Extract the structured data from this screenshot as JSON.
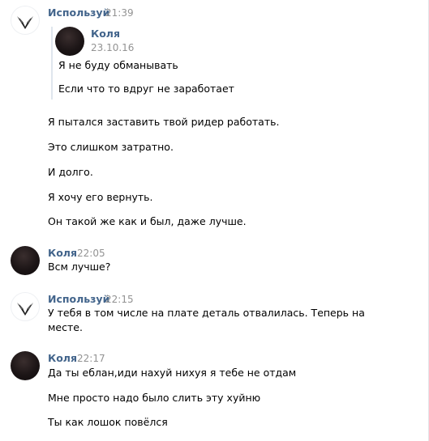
{
  "messages": [
    {
      "author": "Используй",
      "time": "21:39",
      "quote": {
        "author": "Коля",
        "date": "23.10.16",
        "lines": [
          "Я не буду обманывать",
          "Если что то вдруг не заработает"
        ]
      },
      "lines": [
        "Я пытался заставить твой ридер работать.",
        "Это слишком затратно.",
        "И долго.",
        "Я хочу его вернуть.",
        "Он такой же как и был, даже лучше."
      ]
    },
    {
      "author": "Коля",
      "time": "22:05",
      "lines": [
        "Всм лучше?"
      ]
    },
    {
      "author": "Используй",
      "time": "22:15",
      "lines": [
        "У тебя в том числе на плате деталь отвалилась. Теперь на",
        "месте."
      ]
    },
    {
      "author": "Коля",
      "time": "22:17",
      "lines": [
        "Да ты еблан,иди нахуй нихуя я тебе не отдам",
        "Мне просто надо было слить эту хуйню",
        "Ты как лошок повёлся"
      ]
    }
  ]
}
